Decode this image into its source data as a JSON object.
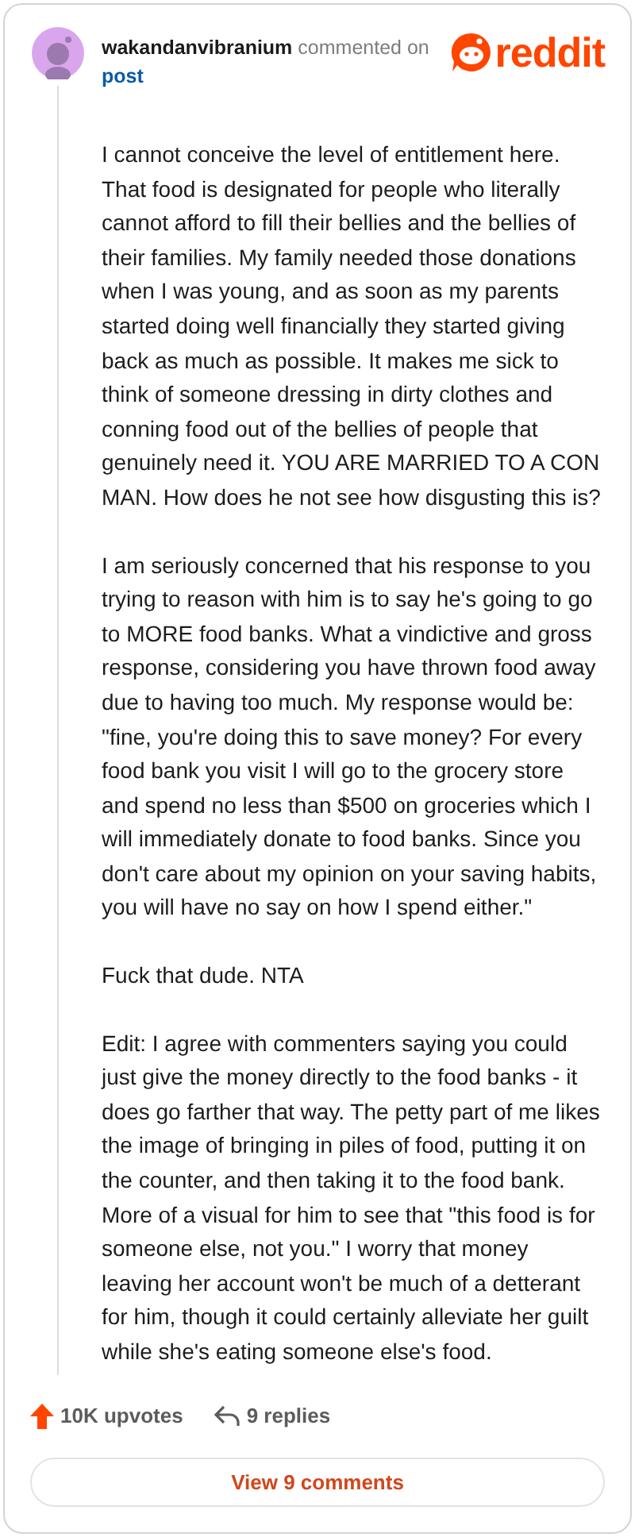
{
  "comment": {
    "author": "wakandanvibranium",
    "action": "commented on",
    "target": "post",
    "logo_text": "reddit",
    "paragraphs": [
      "I cannot conceive the level of entitlement here. That food is designated for people who literally cannot afford to fill their bellies and the bellies of their families. My family needed those donations when I was young, and as soon as my parents started doing well financially they started giving back as much as possible. It makes me sick to think of someone dressing in dirty clothes and conning food out of the bellies of people that genuinely need it. YOU ARE MARRIED TO A CON MAN. How does he not see how disgusting this is?",
      "I am seriously concerned that his response to you trying to reason with him is to say he's going to go to MORE food banks. What a vindictive and gross response, considering you have thrown food away due to having too much. My response would be: \"fine, you're doing this to save money? For every food bank you visit I will go to the grocery store and spend no less than $500 on groceries which I will immediately donate to food banks. Since you don't care about my opinion on your saving habits, you will have no say on how I spend either.\"",
      "Fuck that dude. NTA",
      "Edit: I agree with commenters saying you could just give the money directly to the food banks - it does go farther that way. The petty part of me likes the image of bringing in piles of food, putting it on the counter, and then taking it to the food bank. More of a visual for him to see that \"this food is for someone else, not you.\" I worry that money leaving her account won't be much of a detterant for him, though it could certainly alleviate her guilt while she's eating someone else's food."
    ],
    "upvotes": "10K upvotes",
    "replies": "9 replies",
    "view_button": "View 9 comments"
  }
}
